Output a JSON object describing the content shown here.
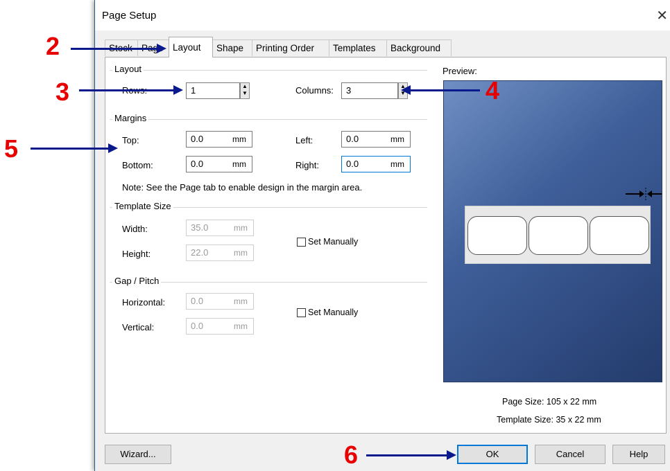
{
  "dialog": {
    "title": "Page Setup",
    "close_label": "✕",
    "tabs": [
      {
        "label": "Stock"
      },
      {
        "label": "Page"
      },
      {
        "label": "Layout"
      },
      {
        "label": "Shape"
      },
      {
        "label": "Printing Order"
      },
      {
        "label": "Templates"
      },
      {
        "label": "Background"
      }
    ],
    "active_tab": "Layout"
  },
  "layout_group": {
    "title": "Layout",
    "rows_label": "Rows:",
    "rows_value": "1",
    "columns_label": "Columns:",
    "columns_value": "3"
  },
  "margins_group": {
    "title": "Margins",
    "top_label": "Top:",
    "top_value": "0.0",
    "bottom_label": "Bottom:",
    "bottom_value": "0.0",
    "left_label": "Left:",
    "left_value": "0.0",
    "right_label": "Right:",
    "right_value": "0.0",
    "unit": "mm",
    "note": "Note: See the Page tab to enable design in the margin area."
  },
  "template_size_group": {
    "title": "Template Size",
    "width_label": "Width:",
    "width_value": "35.0",
    "height_label": "Height:",
    "height_value": "22.0",
    "unit": "mm",
    "set_manually_label": "Set Manually"
  },
  "gap_pitch_group": {
    "title": "Gap / Pitch",
    "horizontal_label": "Horizontal:",
    "horizontal_value": "0.0",
    "vertical_label": "Vertical:",
    "vertical_value": "0.0",
    "unit": "mm",
    "set_manually_label": "Set Manually"
  },
  "preview": {
    "title": "Preview:",
    "page_size": "Page Size:  105 x 22 mm",
    "template_size": "Template Size:  35 x 22 mm"
  },
  "buttons": {
    "wizard": "Wizard...",
    "ok": "OK",
    "cancel": "Cancel",
    "help": "Help"
  },
  "annotations": [
    "2",
    "3",
    "4",
    "5",
    "6"
  ],
  "colors": {
    "annotation_number": "#e60000",
    "annotation_arrow": "#0a1a8c",
    "preview_background": "#3f5f9a"
  }
}
